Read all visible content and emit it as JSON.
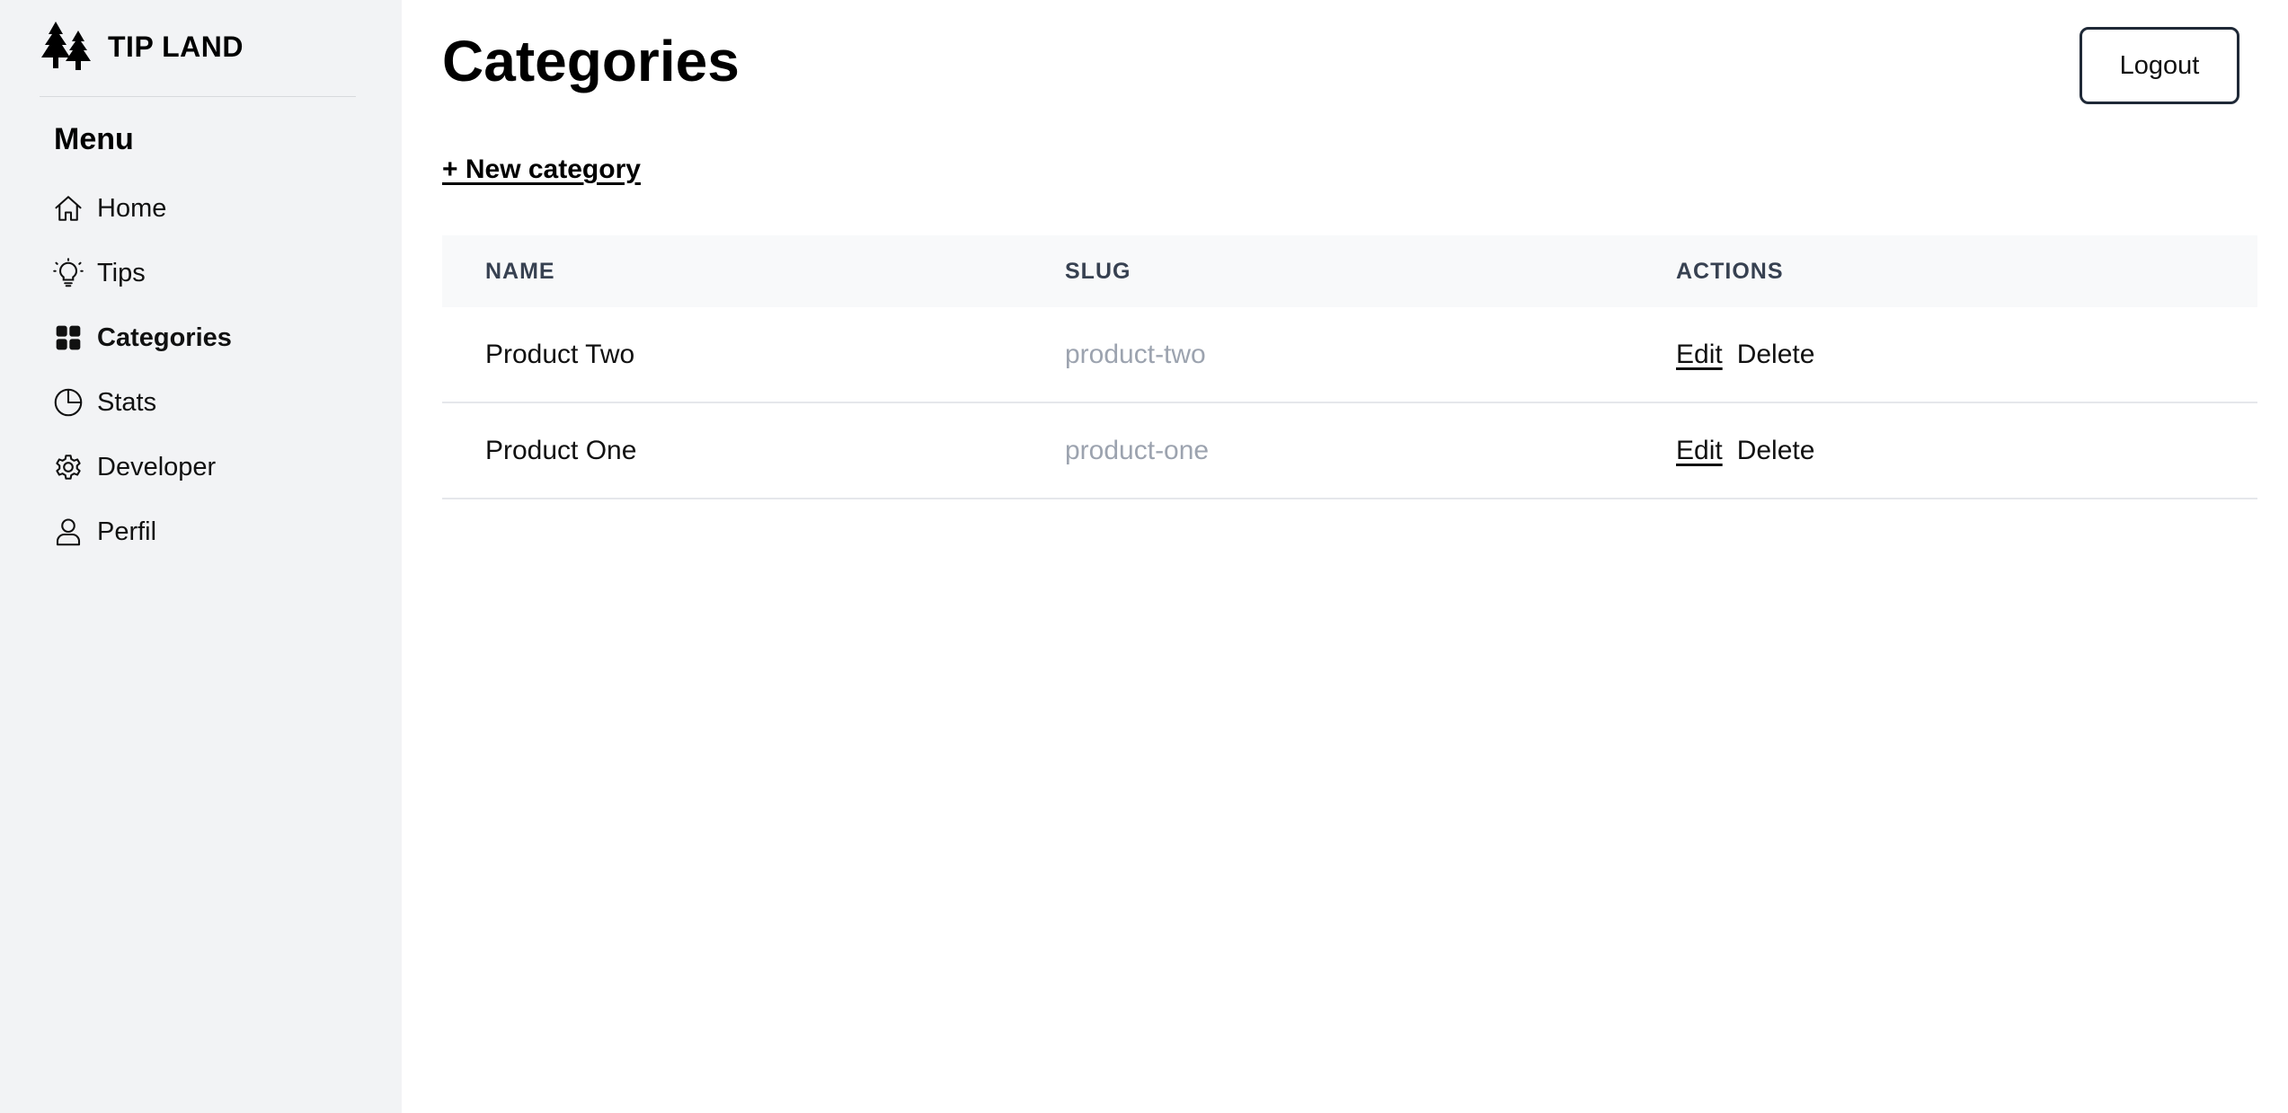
{
  "brand": {
    "name": "TIP LAND",
    "logo_icon": "pine-trees-icon"
  },
  "sidebar": {
    "menu_title": "Menu",
    "items": [
      {
        "label": "Home",
        "icon": "home-icon",
        "active": false
      },
      {
        "label": "Tips",
        "icon": "lightbulb-icon",
        "active": false
      },
      {
        "label": "Categories",
        "icon": "grid-icon",
        "active": true
      },
      {
        "label": "Stats",
        "icon": "pie-chart-icon",
        "active": false
      },
      {
        "label": "Developer",
        "icon": "gear-icon",
        "active": false
      },
      {
        "label": "Perfil",
        "icon": "user-icon",
        "active": false
      }
    ]
  },
  "header": {
    "title": "Categories",
    "logout_label": "Logout"
  },
  "main": {
    "new_category_label": "+ New category",
    "table": {
      "columns": [
        "NAME",
        "SLUG",
        "ACTIONS"
      ],
      "rows": [
        {
          "name": "Product Two",
          "slug": "product-two",
          "edit": "Edit",
          "delete": "Delete"
        },
        {
          "name": "Product One",
          "slug": "product-one",
          "edit": "Edit",
          "delete": "Delete"
        }
      ]
    }
  },
  "colors": {
    "sidebar_bg": "#f2f3f5",
    "table_header_bg": "#f8f9fa",
    "slug_text": "#9ca3af",
    "button_border": "#1f2937"
  }
}
